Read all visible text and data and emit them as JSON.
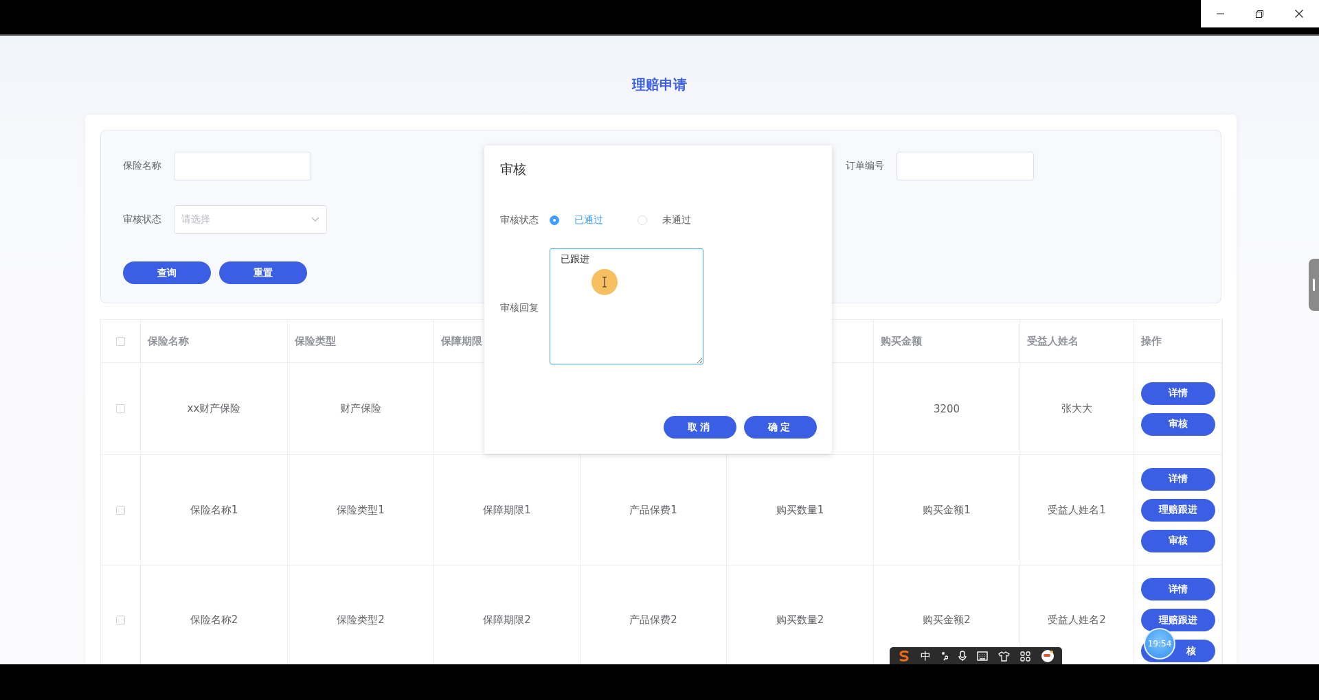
{
  "page_title": "理赔申请",
  "filters": [
    {
      "label": "保险名称",
      "kind": "input"
    },
    {
      "label": "审核状态",
      "kind": "select",
      "placeholder": "请选择"
    },
    {
      "label": "订单编号",
      "kind": "input"
    }
  ],
  "filter_buttons": [
    "查询",
    "重置"
  ],
  "table": {
    "header_checked": false,
    "columns": [
      "保险名称",
      "保险类型",
      "保障期限",
      null,
      null,
      "购买金额",
      "受益人姓名",
      "操作"
    ],
    "rows": [
      {
        "checked": false,
        "cells": [
          "xx财产保险",
          "财产保险",
          null,
          null,
          null,
          "3200",
          "张大大"
        ],
        "actions": [
          "详情",
          "审核"
        ]
      },
      {
        "checked": false,
        "cells": [
          "保险名称1",
          "保险类型1",
          "保障期限1",
          "产品保费1",
          "购买数量1",
          "购买金额1",
          "受益人姓名1"
        ],
        "actions": [
          "详情",
          "理赔跟进",
          "审核"
        ]
      },
      {
        "checked": false,
        "cells": [
          "保险名称2",
          "保险类型2",
          "保障期限2",
          "产品保费2",
          "购买数量2",
          "购买金额2",
          "受益人姓名2"
        ],
        "actions": [
          "详情",
          "理赔跟进",
          "核"
        ]
      }
    ]
  },
  "dialog": {
    "title": "审核",
    "status_label": "审核状态",
    "options": [
      {
        "label": "已通过",
        "selected": true
      },
      {
        "label": "未通过",
        "selected": false
      }
    ],
    "reply_label": "审核回复",
    "reply_value": "已跟进",
    "buttons": [
      "取消",
      "确定"
    ]
  },
  "ime_toolbar": {
    "mode": "中"
  },
  "clock": "19:54"
}
